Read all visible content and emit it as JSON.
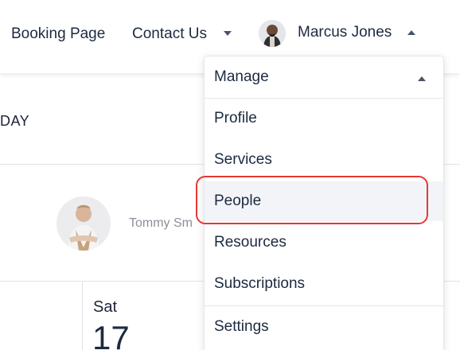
{
  "nav": {
    "booking_page": "Booking Page",
    "contact_us": "Contact Us",
    "user_name": "Marcus Jones"
  },
  "page": {
    "today": "DAY",
    "staff_name": "Tommy Sm",
    "calendar_day": "Sat",
    "calendar_date": "17"
  },
  "dropdown": {
    "header": "Manage",
    "items": [
      "Profile",
      "Services",
      "People",
      "Resources",
      "Subscriptions"
    ],
    "settings": "Settings",
    "highlighted": "People"
  },
  "colors": {
    "highlight": "#e53935",
    "text": "#1c2a40",
    "hover_bg": "#f3f4f8"
  },
  "icons": {
    "contact_caret": "caret-down-icon",
    "user_caret": "caret-up-icon",
    "manage_caret": "caret-up-icon"
  }
}
